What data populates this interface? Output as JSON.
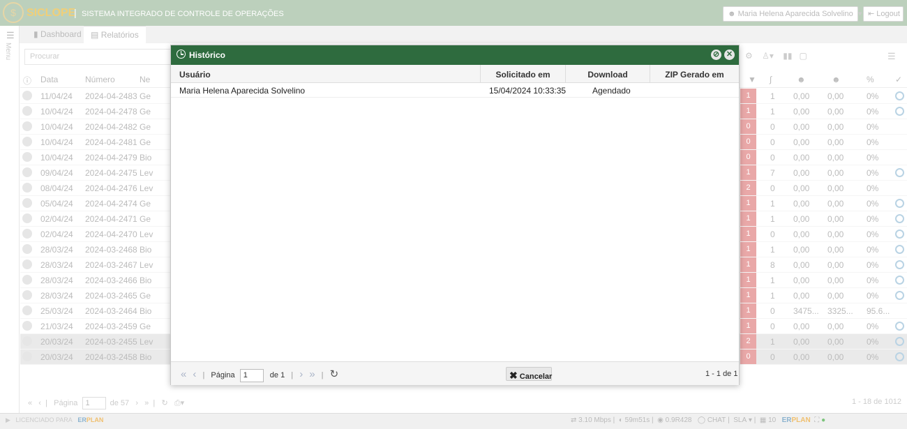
{
  "app": {
    "brand": "SICLOPE",
    "subtitle": "SISTEMA INTEGRADO DE CONTROLE DE OPERAÇÕES",
    "user_name": "Maria Helena Aparecida Solvelino",
    "logout_label": "Logout",
    "menu_label": "Menu"
  },
  "tabs": [
    {
      "label": "Dashboard"
    },
    {
      "label": "Relatórios"
    }
  ],
  "search": {
    "placeholder": "Procurar"
  },
  "table": {
    "headers": {
      "date": "Data",
      "number": "Número",
      "name": "Ne"
    },
    "rows": [
      {
        "date": "11/04/24",
        "number": "2024-04-2483",
        "name": "Ge",
        "badge": "1",
        "att": "1",
        "v1": "0,00",
        "v2": "0,00",
        "pct": "0%",
        "check": true
      },
      {
        "date": "10/04/24",
        "number": "2024-04-2478",
        "name": "Ge",
        "badge": "1",
        "att": "1",
        "v1": "0,00",
        "v2": "0,00",
        "pct": "0%",
        "check": true
      },
      {
        "date": "10/04/24",
        "number": "2024-04-2482",
        "name": "Ge",
        "badge": "0",
        "att": "0",
        "v1": "0,00",
        "v2": "0,00",
        "pct": "0%",
        "check": false
      },
      {
        "date": "10/04/24",
        "number": "2024-04-2481",
        "name": "Ge",
        "badge": "0",
        "att": "0",
        "v1": "0,00",
        "v2": "0,00",
        "pct": "0%",
        "check": false
      },
      {
        "date": "10/04/24",
        "number": "2024-04-2479",
        "name": "Bio",
        "badge": "0",
        "att": "0",
        "v1": "0,00",
        "v2": "0,00",
        "pct": "0%",
        "check": false
      },
      {
        "date": "09/04/24",
        "number": "2024-04-2475",
        "name": "Lev",
        "badge": "1",
        "att": "7",
        "v1": "0,00",
        "v2": "0,00",
        "pct": "0%",
        "check": true
      },
      {
        "date": "08/04/24",
        "number": "2024-04-2476",
        "name": "Lev",
        "badge": "2",
        "att": "0",
        "v1": "0,00",
        "v2": "0,00",
        "pct": "0%",
        "check": false
      },
      {
        "date": "05/04/24",
        "number": "2024-04-2474",
        "name": "Ge",
        "badge": "1",
        "att": "1",
        "v1": "0,00",
        "v2": "0,00",
        "pct": "0%",
        "check": true
      },
      {
        "date": "02/04/24",
        "number": "2024-04-2471",
        "name": "Ge",
        "badge": "1",
        "att": "1",
        "v1": "0,00",
        "v2": "0,00",
        "pct": "0%",
        "check": true
      },
      {
        "date": "02/04/24",
        "number": "2024-04-2470",
        "name": "Lev",
        "badge": "1",
        "att": "0",
        "v1": "0,00",
        "v2": "0,00",
        "pct": "0%",
        "check": true
      },
      {
        "date": "28/03/24",
        "number": "2024-03-2468",
        "name": "Bio",
        "badge": "1",
        "att": "1",
        "v1": "0,00",
        "v2": "0,00",
        "pct": "0%",
        "check": true
      },
      {
        "date": "28/03/24",
        "number": "2024-03-2467",
        "name": "Lev",
        "badge": "1",
        "att": "8",
        "v1": "0,00",
        "v2": "0,00",
        "pct": "0%",
        "check": true
      },
      {
        "date": "28/03/24",
        "number": "2024-03-2466",
        "name": "Bio",
        "badge": "1",
        "att": "1",
        "v1": "0,00",
        "v2": "0,00",
        "pct": "0%",
        "check": true
      },
      {
        "date": "28/03/24",
        "number": "2024-03-2465",
        "name": "Ge",
        "badge": "1",
        "att": "1",
        "v1": "0,00",
        "v2": "0,00",
        "pct": "0%",
        "check": true
      },
      {
        "date": "25/03/24",
        "number": "2024-03-2464",
        "name": "Bio",
        "badge": "1",
        "att": "0",
        "v1": "3475...",
        "v2": "3325...",
        "pct": "95.6...",
        "check": false
      },
      {
        "date": "21/03/24",
        "number": "2024-03-2459",
        "name": "Ge",
        "badge": "1",
        "att": "0",
        "v1": "0,00",
        "v2": "0,00",
        "pct": "0%",
        "check": true
      },
      {
        "date": "20/03/24",
        "number": "2024-03-2455",
        "name": "Lev",
        "badge": "2",
        "att": "1",
        "v1": "0,00",
        "v2": "0,00",
        "pct": "0%",
        "check": true
      },
      {
        "date": "20/03/24",
        "number": "2024-03-2458",
        "name": "Bio",
        "badge": "0",
        "att": "0",
        "v1": "0,00",
        "v2": "0,00",
        "pct": "0%",
        "check": true
      }
    ]
  },
  "pager": {
    "page_label": "Página",
    "page_value": "1",
    "of_label": "de 57",
    "count": "1 - 18 de 1012"
  },
  "footer": {
    "licensed": "LICENCIADO PARA",
    "erplan_e": "ER",
    "erplan_p": "PLAN",
    "speed": "3.10 Mbps",
    "uptime": "59m51s",
    "version": "0.9R428",
    "chat": "CHAT",
    "sla": "SLA",
    "notif_count": "10"
  },
  "modal": {
    "title": "Histórico",
    "headers": {
      "user": "Usuário",
      "requested": "Solicitado em",
      "download": "Download",
      "zip": "ZIP Gerado em"
    },
    "rows": [
      {
        "user": "Maria Helena Aparecida Solvelino",
        "requested": "15/04/2024 10:33:35",
        "download": "Agendado",
        "zip": ""
      }
    ],
    "page_label": "Página",
    "page_value": "1",
    "of_label": "de 1",
    "cancel_label": "Cancelar",
    "count": "1 - 1 de 1"
  },
  "colors": {
    "header": "#2e6b3e",
    "topbar": "#bcd0bc",
    "badge": "#e9a8a8"
  }
}
